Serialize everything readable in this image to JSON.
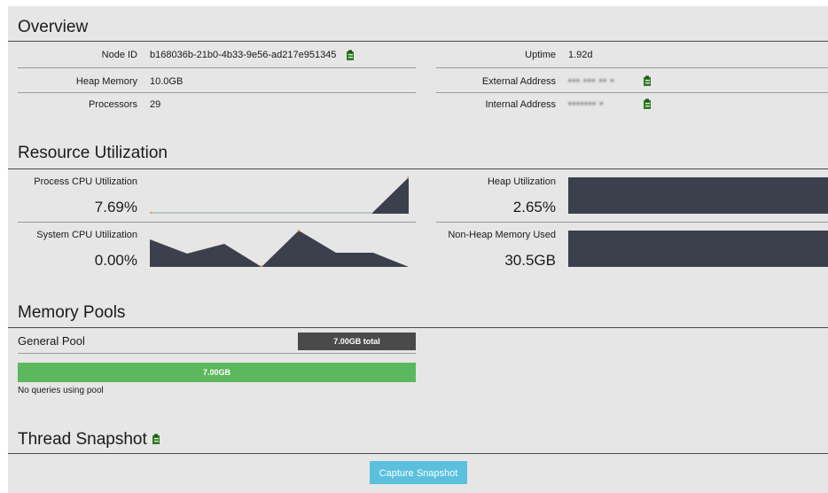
{
  "overview": {
    "title": "Overview",
    "node_id_label": "Node ID",
    "node_id_value": "b168036b-21b0-4b33-9e56-ad217e951345",
    "heap_memory_label": "Heap Memory",
    "heap_memory_value": "10.0GB",
    "processors_label": "Processors",
    "processors_value": "29",
    "uptime_label": "Uptime",
    "uptime_value": "1.92d",
    "external_address_label": "External Address",
    "internal_address_label": "Internal Address"
  },
  "resource": {
    "title": "Resource Utilization",
    "process_cpu_label": "Process CPU Utilization",
    "process_cpu_value": "7.69%",
    "system_cpu_label": "System CPU Utilization",
    "system_cpu_value": "0.00%",
    "heap_util_label": "Heap Utilization",
    "heap_util_value": "2.65%",
    "non_heap_label": "Non-Heap Memory Used",
    "non_heap_value": "30.5GB"
  },
  "memory_pools": {
    "title": "Memory Pools",
    "general_pool_label": "General Pool",
    "total_badge": "7.00GB total",
    "bar_label": "7.00GB",
    "bar_fraction": 1.0,
    "no_queries": "No queries using pool"
  },
  "thread": {
    "title": "Thread Snapshot",
    "capture_button": "Capture Snapshot"
  },
  "colors": {
    "sparkline_fill": "#3b404c",
    "bar_green": "#5cb85c",
    "badge_dark": "#4a4a4a",
    "button_blue": "#5bc0de",
    "clipboard_green": "#2e7d1f"
  },
  "icons": {
    "copy": "clipboard-icon"
  }
}
